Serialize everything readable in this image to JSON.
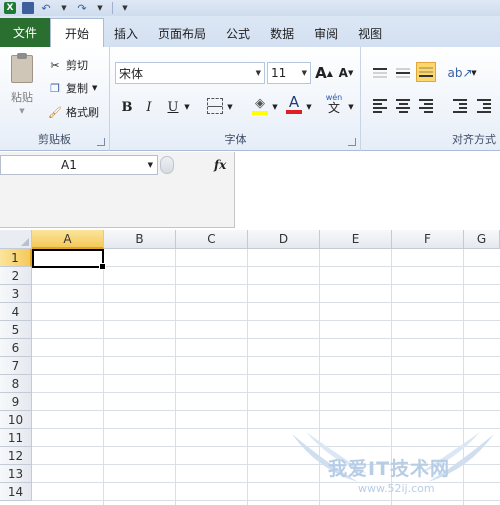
{
  "tabs": [
    {
      "label": "文件"
    },
    {
      "label": "开始"
    },
    {
      "label": "插入"
    },
    {
      "label": "页面布局"
    },
    {
      "label": "公式"
    },
    {
      "label": "数据"
    },
    {
      "label": "审阅"
    },
    {
      "label": "视图"
    }
  ],
  "clipboard": {
    "paste_label": "粘贴",
    "cut_label": "剪切",
    "copy_label": "复制",
    "format_painter_label": "格式刷",
    "group_label": "剪贴板"
  },
  "font": {
    "name": "宋体",
    "size": "11",
    "bold": "B",
    "italic": "I",
    "underline": "U",
    "grow": "A",
    "shrink": "A",
    "font_color_glyph": "A",
    "phonetic_glyph": "wén",
    "phonetic_char": "文",
    "group_label": "字体"
  },
  "alignment": {
    "group_label": "对齐方式"
  },
  "formula_bar": {
    "name_box": "A1",
    "fx": "fx",
    "value": ""
  },
  "grid": {
    "columns": [
      "A",
      "B",
      "C",
      "D",
      "E",
      "F",
      "G"
    ],
    "rows": [
      "1",
      "2",
      "3",
      "4",
      "5",
      "6",
      "7",
      "8",
      "9",
      "10",
      "11",
      "12",
      "13",
      "14"
    ],
    "selected_cell": "A1"
  },
  "watermark": {
    "text": "我爱IT技术网",
    "url": "www.52ij.com"
  },
  "colors": {
    "file_tab": "#2a6e30",
    "selection_header": "#f5c95b",
    "highlight_fill": "#ffff00",
    "font_color": "#e02020"
  }
}
